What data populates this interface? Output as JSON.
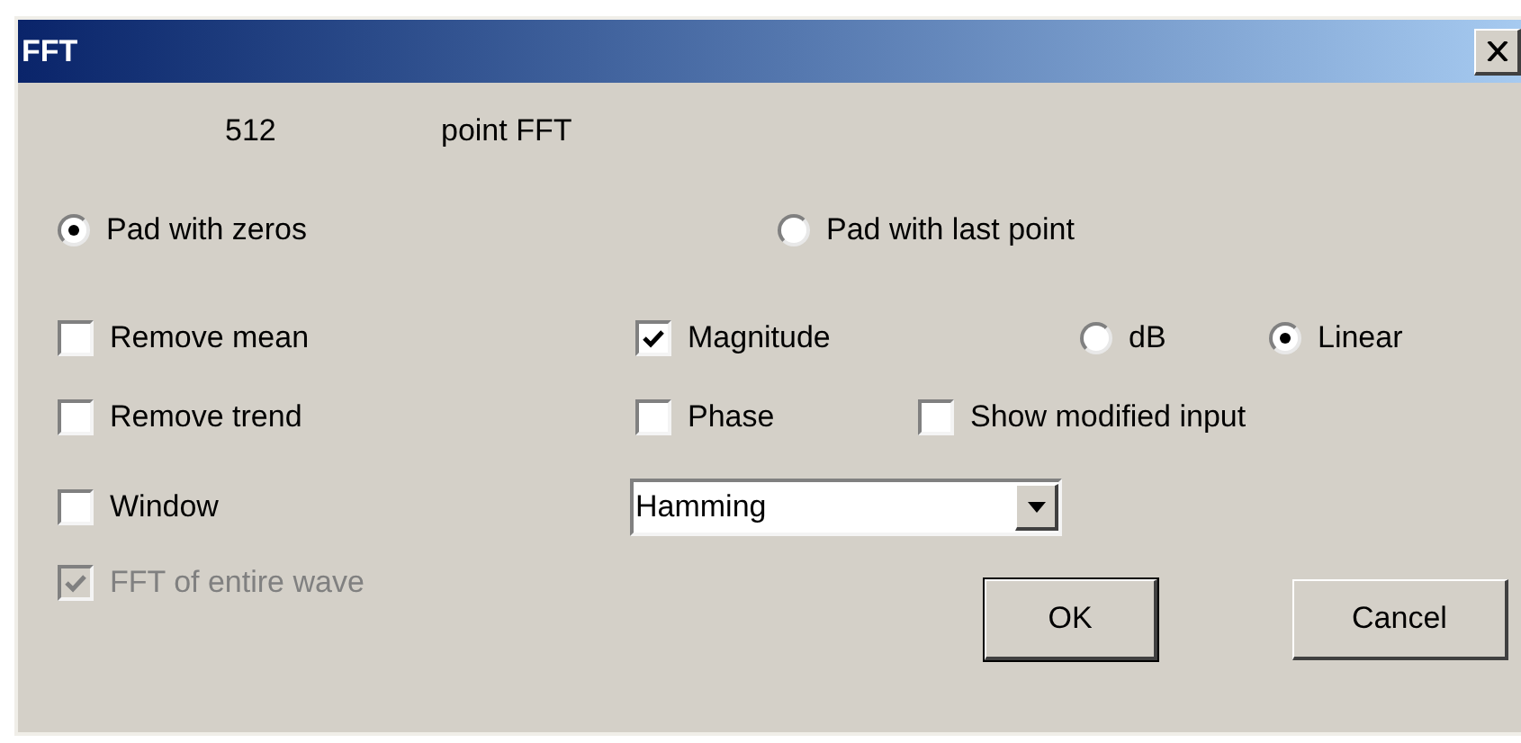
{
  "window": {
    "title": "FFT"
  },
  "fft_size": {
    "value": "512",
    "label": "point FFT"
  },
  "padding": [
    {
      "label": "Pad with zeros",
      "selected": true
    },
    {
      "label": "Pad with last point",
      "selected": false
    }
  ],
  "rows": [
    {
      "items": [
        {
          "kind": "checkbox",
          "label": "Remove mean",
          "checked": false
        },
        {
          "kind": "checkbox",
          "label": "Magnitude",
          "checked": true
        },
        {
          "kind": "radio",
          "label": "dB",
          "selected": false
        },
        {
          "kind": "radio",
          "label": "Linear",
          "selected": true
        }
      ]
    },
    {
      "items": [
        {
          "kind": "checkbox",
          "label": "Remove trend",
          "checked": false
        },
        {
          "kind": "checkbox",
          "label": "Phase",
          "checked": false
        },
        {
          "kind": "checkbox",
          "label": "Show modified input",
          "checked": false
        }
      ]
    },
    {
      "items": [
        {
          "kind": "checkbox",
          "label": "Window",
          "checked": false
        },
        {
          "kind": "dropdown",
          "value": "Hamming"
        }
      ]
    }
  ],
  "entire_wave": {
    "label": "FFT of entire wave",
    "checked": true,
    "disabled": true
  },
  "buttons": [
    {
      "label": "OK",
      "default": true
    },
    {
      "label": "Cancel",
      "default": false
    }
  ]
}
